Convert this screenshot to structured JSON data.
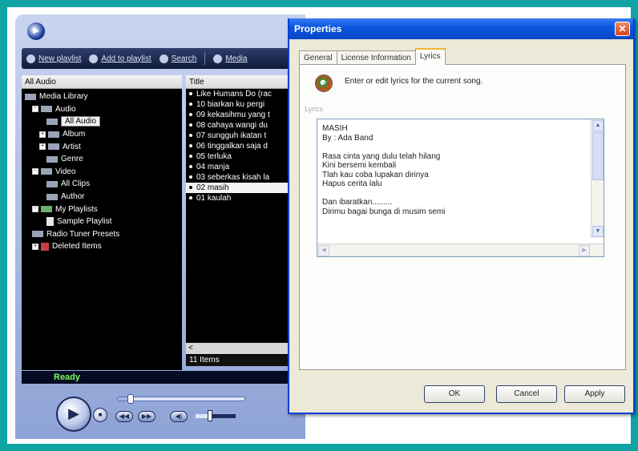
{
  "colors": {
    "background": "#0fa3a3",
    "status_ok": "#7dfa5d",
    "dialog_titlebar": "#0a58e0",
    "tab_highlight": "#f3b436"
  },
  "player": {
    "logo_icon": "windows-media-player-logo",
    "toolbar": [
      {
        "label": "New playlist",
        "icon": "new-playlist-icon"
      },
      {
        "label": "Add to playlist",
        "icon": "add-to-playlist-icon"
      },
      {
        "label": "Search",
        "icon": "search-icon"
      },
      {
        "label": "Media",
        "icon": "media-icon"
      }
    ],
    "library_header": "All Audio",
    "tree": [
      {
        "label": "Media Library",
        "indent": 0,
        "expander": "",
        "icon": "folder"
      },
      {
        "label": "Audio",
        "indent": 1,
        "expander": "-",
        "icon": "folder"
      },
      {
        "label": "All Audio",
        "indent": 3,
        "expander": "",
        "icon": "folder",
        "selected": true
      },
      {
        "label": "Album",
        "indent": 2,
        "expander": "+",
        "icon": "folder"
      },
      {
        "label": "Artist",
        "indent": 2,
        "expander": "+",
        "icon": "folder"
      },
      {
        "label": "Genre",
        "indent": 3,
        "expander": "",
        "icon": "folder"
      },
      {
        "label": "Video",
        "indent": 1,
        "expander": "-",
        "icon": "folder"
      },
      {
        "label": "All Clips",
        "indent": 3,
        "expander": "",
        "icon": "folder"
      },
      {
        "label": "Author",
        "indent": 3,
        "expander": "",
        "icon": "folder"
      },
      {
        "label": "My Playlists",
        "indent": 1,
        "expander": "-",
        "icon": "mix"
      },
      {
        "label": "Sample Playlist",
        "indent": 3,
        "expander": "",
        "icon": "doc"
      },
      {
        "label": "Radio Tuner Presets",
        "indent": 1,
        "expander": "",
        "icon": "folder"
      },
      {
        "label": "Deleted Items",
        "indent": 1,
        "expander": "+",
        "icon": "red"
      }
    ],
    "title_header": "Title",
    "tracks": [
      {
        "label": "Like Humans Do (rac"
      },
      {
        "label": "10 biarkan ku pergi"
      },
      {
        "label": "09 kekasihmu yang t"
      },
      {
        "label": "08 cahaya wangi du"
      },
      {
        "label": "07 sungguh ikatan t"
      },
      {
        "label": "06 tinggalkan saja d"
      },
      {
        "label": "05 terluka"
      },
      {
        "label": "04 manja"
      },
      {
        "label": "03 seberkas kisah la"
      },
      {
        "label": "02 masih",
        "current": true
      },
      {
        "label": "01 kaulah"
      }
    ],
    "scroll_left": "<",
    "item_count": "11 Items",
    "status": "Ready",
    "controls": {
      "play_icon": "play-icon",
      "stop_icon": "stop-icon",
      "previous_icon": "previous-icon",
      "next_icon": "next-icon",
      "mute_icon": "mute-icon",
      "seek_position": 0.1,
      "volume_level": 0.35
    }
  },
  "dialog": {
    "title": "Properties",
    "close_glyph": "✕",
    "tabs": [
      {
        "label": "General",
        "active": false
      },
      {
        "label": "License Information",
        "active": false
      },
      {
        "label": "Lyrics",
        "active": true
      }
    ],
    "instruction": "Enter or edit lyrics for the current song.",
    "group_label": "Lyrics",
    "lyrics": "MASIH\nBy : Ada Band\n\nRasa cinta yang dulu telah hilang\nKini bersemi kembali\nTlah kau coba lupakan dirinya\nHapus cerita lalu\n\nDan ibaratkan.........\nDirimu bagai bunga di musim semi",
    "buttons": {
      "ok": "OK",
      "cancel": "Cancel",
      "apply": "Apply"
    }
  }
}
